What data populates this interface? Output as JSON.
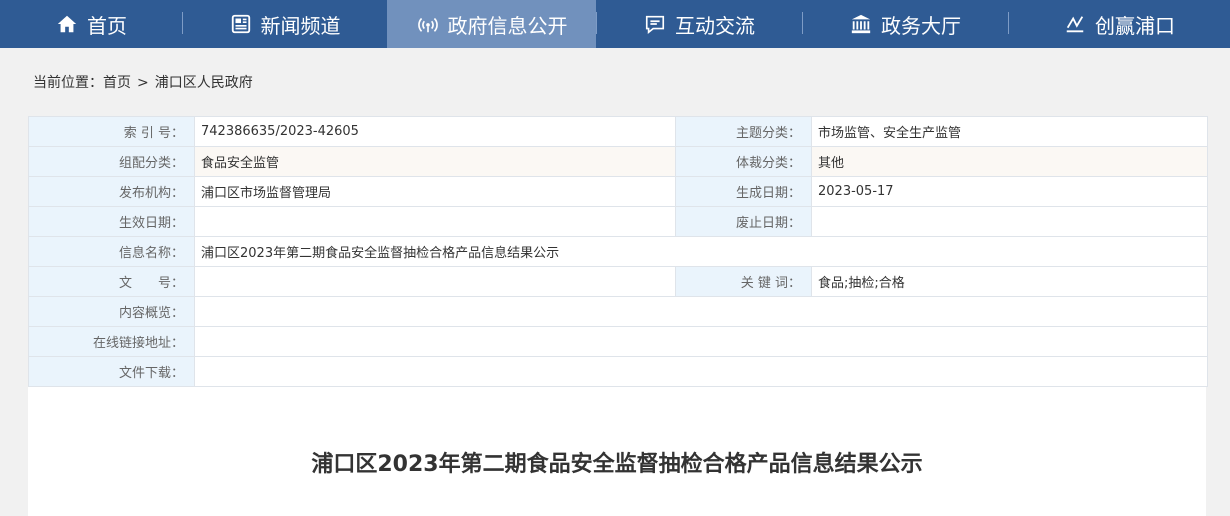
{
  "nav": {
    "items": [
      {
        "label": "首页",
        "icon": "home-icon"
      },
      {
        "label": "新闻频道",
        "icon": "newspaper-icon"
      },
      {
        "label": "政府信息公开",
        "icon": "broadcast-icon",
        "active": true
      },
      {
        "label": "互动交流",
        "icon": "chat-icon"
      },
      {
        "label": "政务大厅",
        "icon": "government-building-icon"
      },
      {
        "label": "创赢浦口",
        "icon": "growth-chart-icon"
      }
    ],
    "colors": {
      "bar": "#2f5b94",
      "active": "#7191bd"
    }
  },
  "breadcrumb": {
    "prefix": "当前位置：",
    "items": [
      "首页",
      "浦口区人民政府"
    ],
    "separator": ">"
  },
  "meta": {
    "index_label": "索 引 号：",
    "index_value": "742386635/2023-42605",
    "topic_label": "主题分类：",
    "topic_value": "市场监管、安全生产监管",
    "group_label": "组配分类：",
    "group_value": "食品安全监管",
    "genre_label": "体裁分类：",
    "genre_value": "其他",
    "org_label": "发布机构：",
    "org_value": "浦口区市场监督管理局",
    "created_label": "生成日期：",
    "created_value": "2023-05-17",
    "effective_label": "生效日期：",
    "effective_value": "",
    "abolished_label": "废止日期：",
    "abolished_value": "",
    "name_label": "信息名称：",
    "name_value": "浦口区2023年第二期食品安全监督抽检合格产品信息结果公示",
    "docno_label": "文　　号：",
    "docno_value": "",
    "keywords_label": "关 键 词：",
    "keywords_value": "食品;抽检;合格",
    "summary_label": "内容概览：",
    "summary_value": "",
    "link_label": "在线链接地址：",
    "link_value": "",
    "download_label": "文件下载：",
    "download_value": ""
  },
  "article": {
    "title": "浦口区2023年第二期食品安全监督抽检合格产品信息结果公示"
  }
}
